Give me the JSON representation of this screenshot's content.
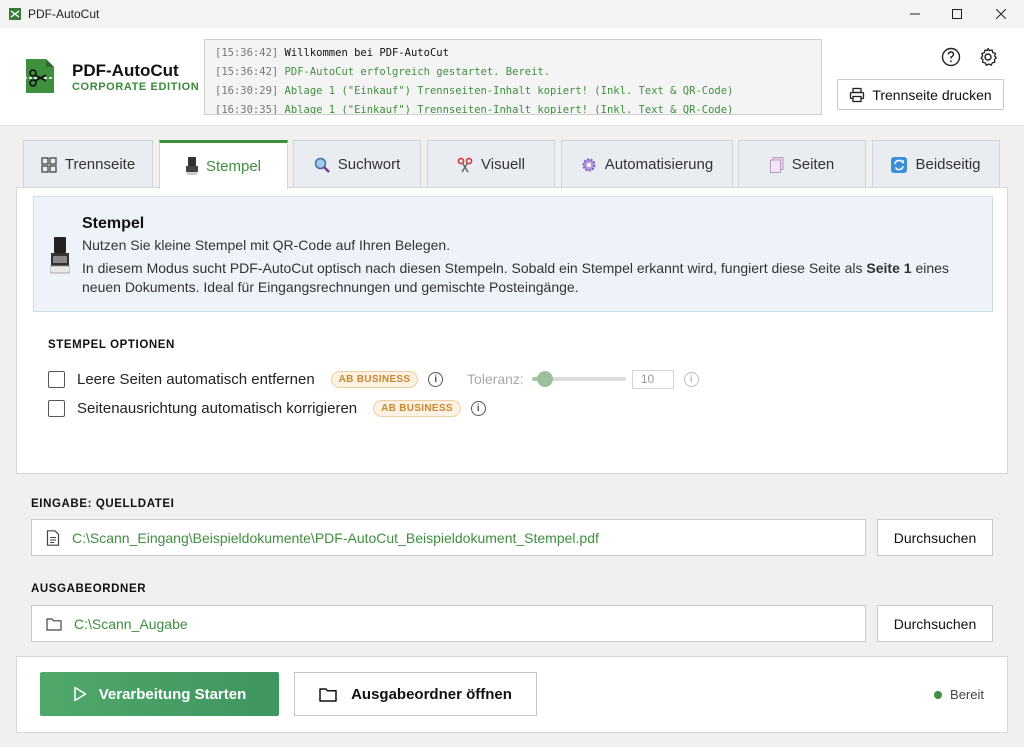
{
  "window": {
    "title": "PDF-AutoCut"
  },
  "brand": {
    "name": "PDF-AutoCut",
    "edition": "CORPORATE EDITION"
  },
  "log": [
    {
      "time": "[15:36:42]",
      "message": "Willkommen bei PDF-AutoCut",
      "style": "plain"
    },
    {
      "time": "[15:36:42]",
      "message": "PDF-AutoCut erfolgreich gestartet. Bereit.",
      "style": "green"
    },
    {
      "time": "[16:30:29]",
      "message": "Ablage 1 (\"Einkauf\") Trennseiten-Inhalt kopiert! (Inkl. Text & QR-Code)",
      "style": "green"
    },
    {
      "time": "[16:30:35]",
      "message": "Ablage 1 (\"Einkauf\") Trennseiten-Inhalt kopiert! (Inkl. Text & QR-Code)",
      "style": "green"
    }
  ],
  "header": {
    "print_label": "Trennseite drucken"
  },
  "tabs": [
    {
      "label": "Trennseite",
      "icon": "grid-icon"
    },
    {
      "label": "Stempel",
      "icon": "stamp-icon"
    },
    {
      "label": "Suchwort",
      "icon": "magnifier-icon"
    },
    {
      "label": "Visuell",
      "icon": "scissors-icon"
    },
    {
      "label": "Automatisierung",
      "icon": "gear-icon"
    },
    {
      "label": "Seiten",
      "icon": "pages-icon"
    },
    {
      "label": "Beidseitig",
      "icon": "refresh-icon"
    }
  ],
  "active_tab": "Stempel",
  "info": {
    "title": "Stempel",
    "line1": "Nutzen Sie kleine Stempel mit QR-Code auf Ihren Belegen.",
    "line2_pre": "In diesem Modus sucht PDF-AutoCut optisch nach diesen Stempeln. Sobald ein Stempel erkannt wird, fungiert diese Seite als ",
    "line2_bold": "Seite 1",
    "line2_post": " eines",
    "line3": "neuen Dokuments. Ideal für Eingangsrechnungen und gemischte Posteingänge."
  },
  "options": {
    "heading": "STEMPEL OPTIONEN",
    "remove_empty": {
      "label": "Leere Seiten automatisch entfernen",
      "badge": "AB BUSINESS",
      "checked": false
    },
    "fix_orientation": {
      "label": "Seitenausrichtung automatisch korrigieren",
      "badge": "AB BUSINESS",
      "checked": false
    },
    "tolerance": {
      "label": "Toleranz:",
      "value": "10",
      "slider_fraction": 0.14
    }
  },
  "input": {
    "label": "EINGABE: QUELLDATEI",
    "path": "C:\\Scann_Eingang\\Beispieldokumente\\PDF-AutoCut_Beispieldokument_Stempel.pdf",
    "browse": "Durchsuchen"
  },
  "output": {
    "label": "AUSGABEORDNER",
    "path": "C:\\Scann_Augabe",
    "browse": "Durchsuchen"
  },
  "footer": {
    "start": "Verarbeitung Starten",
    "open": "Ausgabeordner öffnen",
    "status": "Bereit"
  },
  "colors": {
    "accent": "#3f8f3f",
    "badge": "#c98a2e"
  }
}
